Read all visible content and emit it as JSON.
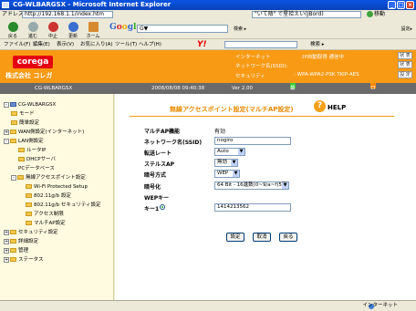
{
  "window": {
    "title": "CG-WLBARGSX - Microsoft Internet Explorer"
  },
  "address": {
    "label": "アドレス(D)",
    "url": "http://192.168.1.1/index.htm",
    "search_text": "\"いて陰\" で星拾えい(JBord)",
    "go": "移動"
  },
  "toolbar": {
    "back": "戻る",
    "forward": "進む",
    "stop": "中止",
    "refresh": "更新",
    "home": "ホーム",
    "google_logo": [
      "G",
      "o",
      "o",
      "g",
      "l",
      "e"
    ],
    "google_input": "G▼",
    "google_search": "検索 ▸",
    "settings": "設定▸"
  },
  "menu": {
    "items": [
      "ファイル(F)",
      "編集(E)",
      "表示(V)",
      "お気に入り(A)",
      "ツール(T)",
      "ヘルプ(H)"
    ],
    "yahoo": "Y!",
    "search2": "検索 ▸"
  },
  "brand": {
    "logo": "corega",
    "company": "株式会社 コレガ"
  },
  "header_info": {
    "rows": [
      {
        "key": "インターネット",
        "val": ":IP自動取得 通信中",
        "pill": "状 表"
      },
      {
        "key": "ネットワーク名(SSID):",
        "val": "",
        "pill": "状 表"
      },
      {
        "key": "セキュリティ",
        "val": ": WPA-WPA2-PSK TKIP-AES",
        "pill": "設 定"
      }
    ]
  },
  "statusbar2": {
    "device": "CG-WLBARGSX",
    "datetime": "2008/08/08 09:40:38",
    "version": "Ver 2.00",
    "firmware": "最新ファームウェアの確認",
    "logout": "ログアウト"
  },
  "sidebar": {
    "items": [
      {
        "label": "CG-WLBARGSX",
        "level": 0,
        "pm": "-",
        "type": "root"
      },
      {
        "label": "モード",
        "level": 1,
        "pm": "",
        "type": "folder"
      },
      {
        "label": "簡単設定",
        "level": 1,
        "pm": "",
        "type": "folder"
      },
      {
        "label": "WAN側設定(インターネット)",
        "level": 0,
        "pm": "+",
        "type": "folder"
      },
      {
        "label": "LAN側設定",
        "level": 0,
        "pm": "-",
        "type": "folder"
      },
      {
        "label": "ルータIP",
        "level": 2,
        "pm": "",
        "type": "folder"
      },
      {
        "label": "DHCPサーバ",
        "level": 2,
        "pm": "",
        "type": "folder"
      },
      {
        "label": "PCデータベース",
        "level": 2,
        "pm": "",
        "type": "text"
      },
      {
        "label": "無線アクセスポイント設定",
        "level": 1,
        "pm": "-",
        "type": "folder"
      },
      {
        "label": "Wi-Fi Protected Setup",
        "level": 3,
        "pm": "",
        "type": "folder"
      },
      {
        "label": "802.11g/b 設定",
        "level": 3,
        "pm": "",
        "type": "folder"
      },
      {
        "label": "802.11g/b セキュリティ設定",
        "level": 3,
        "pm": "",
        "type": "folder"
      },
      {
        "label": "アクセス制限",
        "level": 3,
        "pm": "",
        "type": "folder"
      },
      {
        "label": "マルチAP設定",
        "level": 3,
        "pm": "",
        "type": "folder"
      },
      {
        "label": "セキュリティ設定",
        "level": 0,
        "pm": "+",
        "type": "folder"
      },
      {
        "label": "詳細設定",
        "level": 0,
        "pm": "+",
        "type": "folder"
      },
      {
        "label": "管理",
        "level": 0,
        "pm": "+",
        "type": "folder"
      },
      {
        "label": "ステータス",
        "level": 0,
        "pm": "+",
        "type": "folder"
      }
    ]
  },
  "form": {
    "title": "無線アクセスポイント設定(マルチAP設定)",
    "help": "HELP",
    "help_icon": "?",
    "fields": [
      {
        "label": "マルチAP機能",
        "value": "有効",
        "kind": "text"
      },
      {
        "label": "ネットワーク名(SSID)",
        "value": "nogiro",
        "kind": "input"
      },
      {
        "label": "転送レート",
        "value": "Auto",
        "kind": "select"
      },
      {
        "label": "ステルスAP",
        "value": "無効",
        "kind": "select"
      },
      {
        "label": "暗号方式",
        "value": "WEP",
        "kind": "select"
      },
      {
        "label": "暗号化",
        "value": "64 Bit - 16進数(0~9/a~f)5桁",
        "kind": "select"
      },
      {
        "label": "WEPキー",
        "value": "",
        "kind": "none"
      }
    ],
    "key1_label": "キー1",
    "key1_value": "1414213562",
    "buttons": [
      "設定",
      "取消",
      "戻る"
    ]
  },
  "ie_status": {
    "zone": "インターネット"
  }
}
